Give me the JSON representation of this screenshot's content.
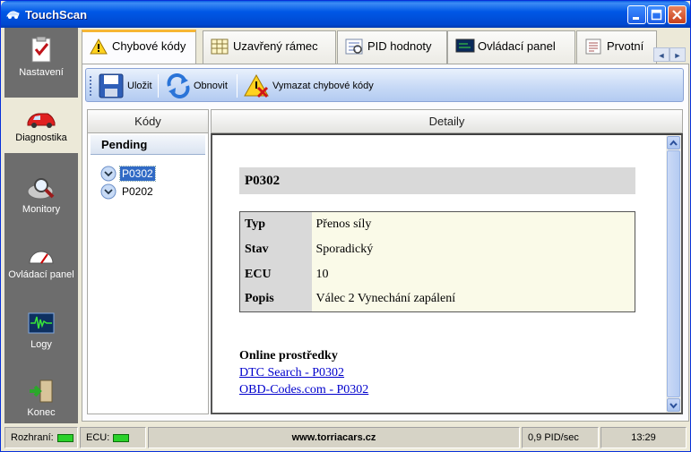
{
  "window": {
    "title": "TouchScan"
  },
  "sidebar": {
    "items": [
      {
        "label": "Nastavení",
        "icon": "checklist-icon"
      },
      {
        "label": "Diagnostika",
        "icon": "car-icon"
      },
      {
        "label": "Monitory",
        "icon": "magnifier-icon"
      },
      {
        "label": "Ovládací panel",
        "icon": "gauge-icon"
      },
      {
        "label": "Logy",
        "icon": "waveform-icon"
      },
      {
        "label": "Konec",
        "icon": "exit-door-icon"
      }
    ]
  },
  "tabs": [
    {
      "label": "Chybové kódy",
      "icon": "warning-icon"
    },
    {
      "label": "Uzavřený rámec",
      "icon": "grid-icon"
    },
    {
      "label": "PID hodnoty",
      "icon": "pid-list-icon"
    },
    {
      "label": "Ovládací panel",
      "icon": "monitor-icon"
    },
    {
      "label": "Prvotní",
      "icon": "document-icon"
    }
  ],
  "toolbar": {
    "save": "Uložit",
    "refresh": "Obnovit",
    "clear": "Vymazat chybové kódy"
  },
  "codes": {
    "header": "Kódy",
    "group": "Pending",
    "items": [
      "P0302",
      "P0202"
    ],
    "selected": "P0302"
  },
  "details": {
    "header": "Detaily",
    "title": "P0302",
    "rows": [
      {
        "key": "Typ",
        "value": "Přenos síly"
      },
      {
        "key": "Stav",
        "value": "Sporadický"
      },
      {
        "key": "ECU",
        "value": "10"
      },
      {
        "key": "Popis",
        "value": "Válec 2 Vynechání zapálení"
      }
    ],
    "resources_title": "Online prostředky",
    "links": [
      "DTC Search - P0302",
      "OBD-Codes.com - P0302"
    ]
  },
  "statusbar": {
    "interface_label": "Rozhraní:",
    "ecu_label": "ECU:",
    "website": "www.torriacars.cz",
    "rate": "0,9 PID/sec",
    "time": "13:29"
  },
  "colors": {
    "titlebar": "#0058e6",
    "sidebar": "#6d6d6d",
    "selection": "#316ac5",
    "link": "#0000cc",
    "led": "#2ad12a",
    "active_tab_accent": "#f6b634"
  }
}
